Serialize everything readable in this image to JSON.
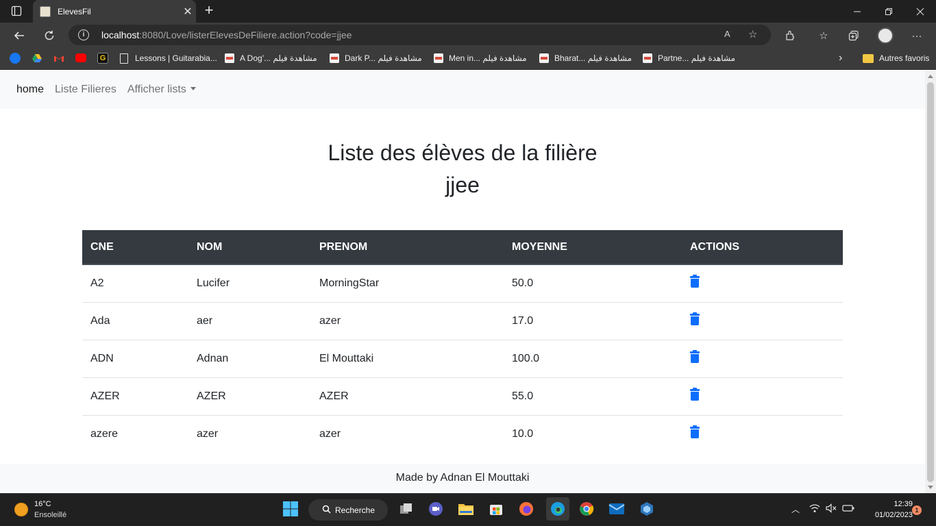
{
  "browser": {
    "tab_title": "ElevesFil",
    "url_host": "localhost",
    "url_path": ":8080/Love/listerElevesDeFiliere.action?code=jjee",
    "bookmarks": [
      {
        "label": "Lessons | Guitarabia..."
      },
      {
        "label": "A Dog'... مشاهدة فيلم"
      },
      {
        "label": "Dark P... مشاهدة فيلم"
      },
      {
        "label": "Men in... مشاهدة فيلم"
      },
      {
        "label": "Bharat... مشاهدة فيلم"
      },
      {
        "label": "Partne... مشاهدة فيلم"
      }
    ],
    "other_favorites": "Autres favoris"
  },
  "nav": {
    "home": "home",
    "liste_filieres": "Liste Filieres",
    "afficher_lists": "Afficher lists"
  },
  "page": {
    "heading_line1": "Liste des élèves de la filière",
    "heading_line2": "jjee"
  },
  "table": {
    "headers": [
      "CNE",
      "NOM",
      "PRENOM",
      "MOYENNE",
      "ACTIONS"
    ],
    "rows": [
      {
        "cne": "A2",
        "nom": "Lucifer",
        "prenom": "MorningStar",
        "moyenne": "50.0"
      },
      {
        "cne": "Ada",
        "nom": "aer",
        "prenom": "azer",
        "moyenne": "17.0"
      },
      {
        "cne": "ADN",
        "nom": "Adnan",
        "prenom": "El Mouttaki",
        "moyenne": "100.0"
      },
      {
        "cne": "AZER",
        "nom": "AZER",
        "prenom": "AZER",
        "moyenne": "55.0"
      },
      {
        "cne": "azere",
        "nom": "azer",
        "prenom": "azer",
        "moyenne": "10.0"
      }
    ],
    "action_icon": "trash-icon",
    "action_color": "#0d6efd"
  },
  "footer": {
    "text": "Made by Adnan El Mouttaki"
  },
  "taskbar": {
    "temperature": "16°C",
    "weather": "Ensoleillé",
    "search_label": "Recherche",
    "time": "12:39",
    "date": "01/02/2023",
    "notification_count": "1"
  }
}
